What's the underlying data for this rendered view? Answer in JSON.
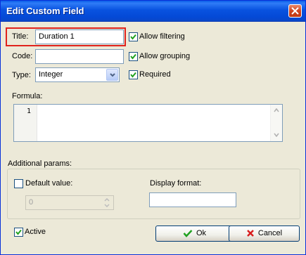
{
  "window": {
    "title": "Edit Custom Field"
  },
  "form": {
    "title_label": "Title:",
    "title_value": "Duration 1",
    "code_label": "Code:",
    "code_value": "",
    "type_label": "Type:",
    "type_value": "Integer",
    "allow_filtering": {
      "label": "Allow filtering",
      "checked": true
    },
    "allow_grouping": {
      "label": "Allow grouping",
      "checked": true
    },
    "required": {
      "label": "Required",
      "checked": true
    },
    "formula_label": "Formula:",
    "formula_line_number": "1",
    "additional_params_label": "Additional params:",
    "default_value": {
      "label": "Default value:",
      "checked": false,
      "value": "0"
    },
    "display_format_label": "Display format:",
    "display_format_value": "",
    "active": {
      "label": "Active",
      "checked": true
    }
  },
  "buttons": {
    "ok_label": "Ok",
    "cancel_label": "Cancel"
  },
  "colors": {
    "title_bar": "#0a5ce8",
    "highlight": "#e0231d",
    "check": "#21a121",
    "cancel_icon": "#d81e1e"
  }
}
